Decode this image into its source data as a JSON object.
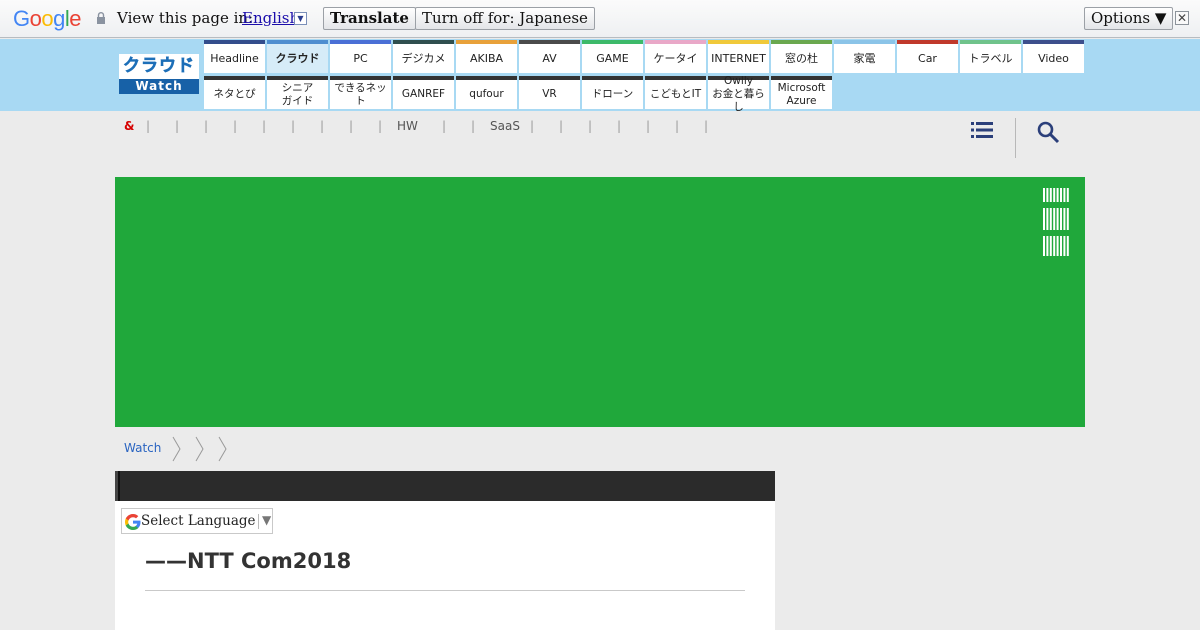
{
  "translate_bar": {
    "logo_letters": [
      "G",
      "o",
      "o",
      "g",
      "l",
      "e"
    ],
    "logo_colors": [
      "#4285f4",
      "#ea4335",
      "#fbbc05",
      "#4285f4",
      "#34a853",
      "#ea4335"
    ],
    "view_text": "View this page in:",
    "language": "English",
    "translate_button": "Translate",
    "turn_off_button": "Turn off for: Japanese",
    "options_button": "Options ▼",
    "close_glyph": "✕"
  },
  "header": {
    "logo_top": "クラウド",
    "logo_bottom": "Watch",
    "nav_row1": [
      {
        "label": "Headline",
        "color": "#334d8c"
      },
      {
        "label": "クラウド",
        "color": "#4e8ed0",
        "active": true
      },
      {
        "label": "PC",
        "color": "#4a6fd6"
      },
      {
        "label": "デジカメ",
        "color": "#2f4f4f"
      },
      {
        "label": "AKIBA",
        "color": "#e8a13a"
      },
      {
        "label": "AV",
        "color": "#4b4b4b"
      },
      {
        "label": "GAME",
        "color": "#3dba6a"
      },
      {
        "label": "ケータイ",
        "color": "#e9a8c8"
      },
      {
        "label": "INTERNET",
        "color": "#f0c93a"
      },
      {
        "label": "窓の杜",
        "color": "#6aa84f"
      },
      {
        "label": "家電",
        "color": "#8bc4e8"
      },
      {
        "label": "Car",
        "color": "#c0392b"
      },
      {
        "label": "トラベル",
        "color": "#6fc38b"
      },
      {
        "label": "Video",
        "color": "#3d4f8c"
      }
    ],
    "nav_row2": [
      {
        "label": "ネタとぴ"
      },
      {
        "label": "シニア\nガイド"
      },
      {
        "label": "できるネット"
      },
      {
        "label": "GANREF"
      },
      {
        "label": "qufour"
      },
      {
        "label": "VR"
      },
      {
        "label": "ドローン"
      },
      {
        "label": "こどもとIT"
      },
      {
        "label": "Owlly\nお金と暮らし"
      },
      {
        "label": "Microsoft\nAzure"
      }
    ]
  },
  "sub_nav": {
    "amp": "&",
    "hw": "HW",
    "saas": "SaaS",
    "separator": "|"
  },
  "icons": {
    "menu": "menu-icon",
    "search": "search-icon"
  },
  "ad": {
    "background": "#20a83b",
    "brand": "IBM"
  },
  "breadcrumb": {
    "home": "Watch"
  },
  "article": {
    "language_select": "Select Language",
    "language_arrow": "▼",
    "title": "——NTT Com2018"
  }
}
